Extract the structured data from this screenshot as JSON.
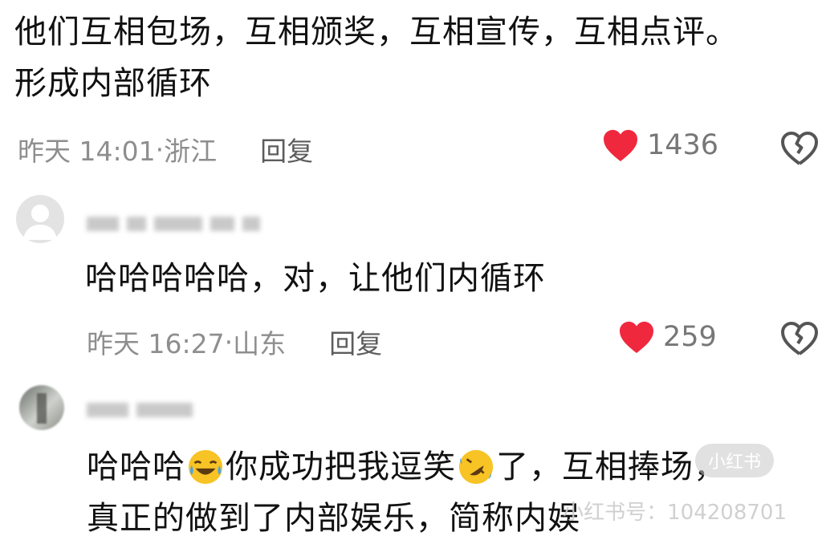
{
  "comments": [
    {
      "text_lines": [
        "他们互相包场，互相颁奖，互相宣传，互相点评。",
        "形成内部循环"
      ],
      "time": "昨天 14:01",
      "location": "浙江",
      "reply_label": "回复",
      "likes": "1436"
    },
    {
      "text_lines": [
        "哈哈哈哈哈，对，让他们内循环"
      ],
      "time": "昨天 16:27",
      "location": "山东",
      "reply_label": "回复",
      "likes": "259"
    },
    {
      "text_parts": [
        "哈哈哈",
        "你成功把我逗笑",
        "了，互相捧场，"
      ],
      "text_line2": "真正的做到了内部娱乐，简称内娱",
      "emojis": [
        "joy-emoji",
        "rofl-emoji"
      ]
    }
  ],
  "separator": "·",
  "watermark": {
    "badge": "小红书",
    "id_text": "小红书号：104208701"
  },
  "colors": {
    "heart": "#f0283e",
    "meta": "#8e8e8e",
    "reply": "#5c5c5c"
  }
}
